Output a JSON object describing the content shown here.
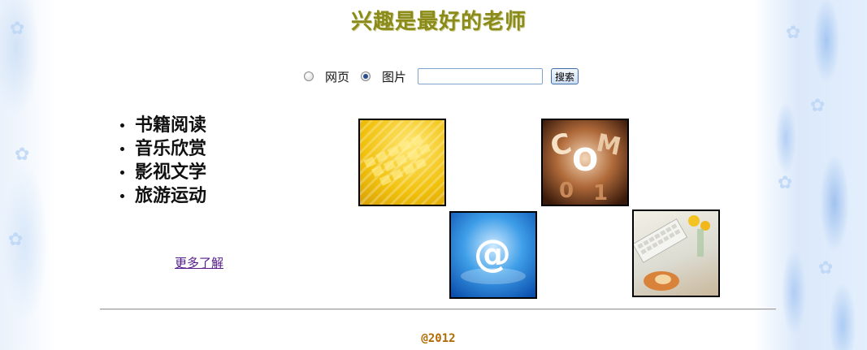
{
  "header": {
    "title": "兴趣是最好的老师"
  },
  "search": {
    "options": [
      {
        "label": "网页",
        "checked": false
      },
      {
        "label": "图片",
        "checked": true
      }
    ],
    "input_value": "",
    "button_label": "搜索"
  },
  "topics": [
    "书籍阅读",
    "音乐欣赏",
    "影视文学",
    "旅游运动"
  ],
  "more_link": "更多了解",
  "images": [
    {
      "icon": "keyboard-photo"
    },
    {
      "icon": "dotcom-photo"
    },
    {
      "icon": "at-symbol-photo"
    },
    {
      "icon": "desk-computer-photo"
    }
  ],
  "footer": {
    "copyright": "@2012"
  },
  "colors": {
    "title": "#8b8b1a",
    "link": "#551a8b",
    "copyright": "#b06a00"
  }
}
